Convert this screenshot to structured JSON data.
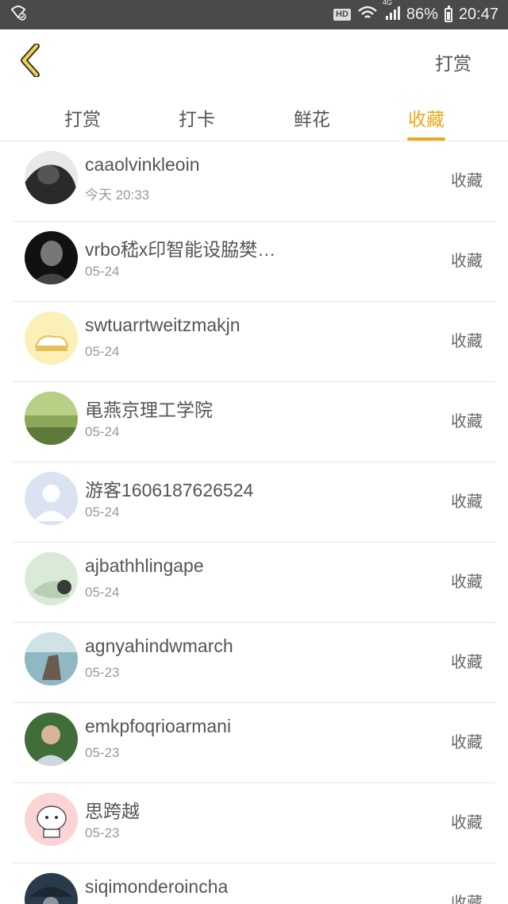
{
  "status_bar": {
    "hd": "HD",
    "network": "4G",
    "battery": "86%",
    "time": "20:47"
  },
  "header": {
    "back_icon": "chevron-left-icon",
    "action_label": "打赏"
  },
  "tabs": [
    {
      "label": "打赏",
      "active": false
    },
    {
      "label": "打卡",
      "active": false
    },
    {
      "label": "鲜花",
      "active": false
    },
    {
      "label": "收藏",
      "active": true
    }
  ],
  "accent_color": "#f0a71a",
  "list": [
    {
      "name": "caaolvinkleoin",
      "date": "今天 20:33",
      "action": "收藏"
    },
    {
      "name": "vrbo嵇x印智能设脇樊…",
      "date": "05-24",
      "action": "收藏"
    },
    {
      "name": "swtuarrtweitzmakjn",
      "date": "05-24",
      "action": "收藏"
    },
    {
      "name": "黾燕京理工学院",
      "date": "05-24",
      "action": "收藏"
    },
    {
      "name": "游客1606187626524",
      "date": "05-24",
      "action": "收藏"
    },
    {
      "name": "ajbathhlingape",
      "date": "05-24",
      "action": "收藏"
    },
    {
      "name": "agnyahindwmarch",
      "date": "05-23",
      "action": "收藏"
    },
    {
      "name": "emkpfoqrioarmani",
      "date": "05-23",
      "action": "收藏"
    },
    {
      "name": "思跨越",
      "date": "05-23",
      "action": "收藏"
    },
    {
      "name": "siqimonderoincha",
      "date": "",
      "action": "收藏"
    }
  ]
}
